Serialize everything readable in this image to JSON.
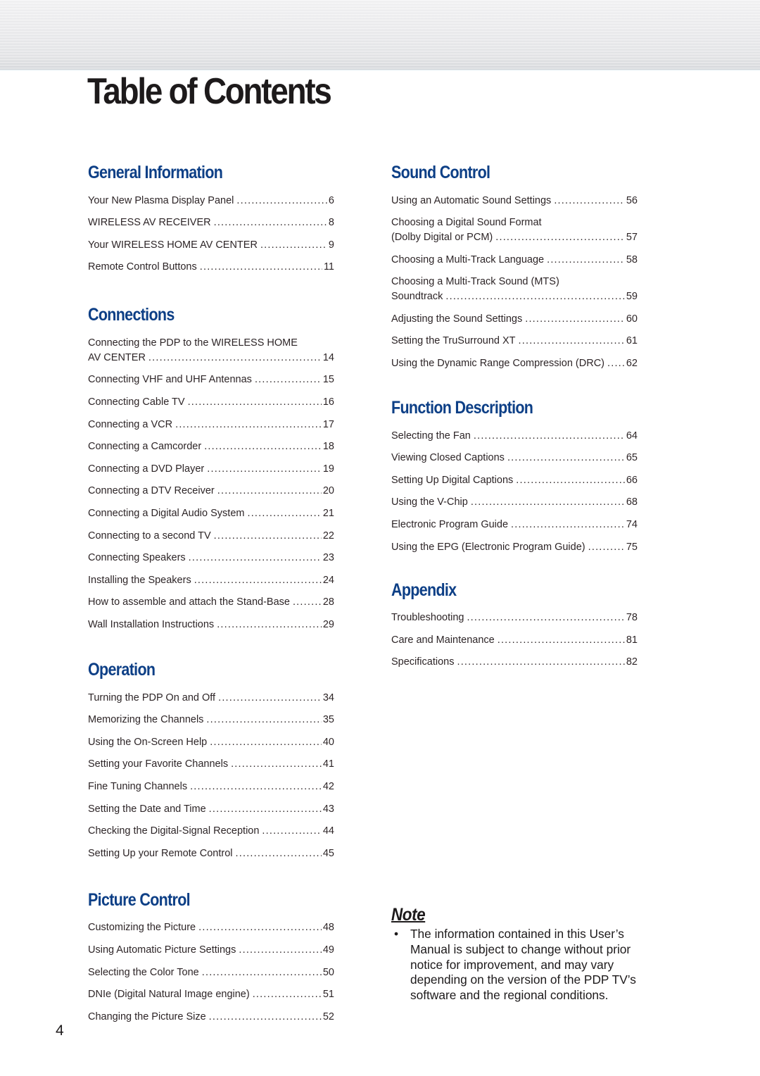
{
  "page": {
    "title": "Table of Contents",
    "page_number": "4"
  },
  "sections": {
    "general": {
      "title": "General Information",
      "entries": [
        {
          "label": "Your New Plasma Display Panel",
          "page": "6"
        },
        {
          "label": "WIRELESS AV RECEIVER",
          "page": "8"
        },
        {
          "label": "Your WIRELESS HOME AV CENTER",
          "page": "9"
        },
        {
          "label": "Remote Control Buttons",
          "page": "11"
        }
      ]
    },
    "connections": {
      "title": "Connections",
      "entries": [
        {
          "label_line1": "Connecting the PDP to the WIRELESS HOME",
          "label": "AV CENTER",
          "page": "14"
        },
        {
          "label": "Connecting VHF and UHF Antennas",
          "page": "15"
        },
        {
          "label": "Connecting Cable TV",
          "page": "16"
        },
        {
          "label": "Connecting a VCR",
          "page": "17"
        },
        {
          "label": "Connecting a Camcorder",
          "page": "18"
        },
        {
          "label": "Connecting a DVD Player",
          "page": "19"
        },
        {
          "label": "Connecting a DTV Receiver",
          "page": "20"
        },
        {
          "label": "Connecting a Digital Audio System",
          "page": "21"
        },
        {
          "label": "Connecting to a second TV",
          "page": "22"
        },
        {
          "label": "Connecting Speakers",
          "page": "23"
        },
        {
          "label": "Installing the Speakers",
          "page": "24"
        },
        {
          "label": "How to assemble and attach the Stand-Base",
          "page": "28"
        },
        {
          "label": "Wall Installation Instructions",
          "page": "29"
        }
      ]
    },
    "operation": {
      "title": "Operation",
      "entries": [
        {
          "label": "Turning the PDP On and Off",
          "page": "34"
        },
        {
          "label": "Memorizing the Channels",
          "page": "35"
        },
        {
          "label": "Using the On-Screen Help",
          "page": "40"
        },
        {
          "label": "Setting your Favorite Channels",
          "page": "41"
        },
        {
          "label": "Fine Tuning Channels",
          "page": "42"
        },
        {
          "label": "Setting the Date and Time",
          "page": "43"
        },
        {
          "label": "Checking the Digital-Signal Reception",
          "page": "44"
        },
        {
          "label": "Setting Up your Remote Control",
          "page": "45"
        }
      ]
    },
    "picture": {
      "title": "Picture Control",
      "entries": [
        {
          "label": "Customizing the Picture",
          "page": "48"
        },
        {
          "label": "Using Automatic Picture Settings",
          "page": "49"
        },
        {
          "label": "Selecting the Color Tone",
          "page": "50"
        },
        {
          "label": "DNIe (Digital Natural Image engine)",
          "page": "51"
        },
        {
          "label": "Changing the Picture Size",
          "page": "52"
        }
      ]
    },
    "sound": {
      "title": "Sound Control",
      "entries": [
        {
          "label": "Using an Automatic Sound Settings",
          "page": "56"
        },
        {
          "label_line1": "Choosing a Digital Sound Format",
          "label": "(Dolby Digital or PCM)",
          "page": "57"
        },
        {
          "label": "Choosing a Multi-Track Language",
          "page": "58"
        },
        {
          "label_line1": "Choosing a Multi-Track Sound (MTS)",
          "label": "Soundtrack",
          "page": "59"
        },
        {
          "label": "Adjusting the Sound Settings",
          "page": "60"
        },
        {
          "label": "Setting the TruSurround XT",
          "page": "61"
        },
        {
          "label": "Using the Dynamic Range Compression (DRC)",
          "page": "62"
        }
      ]
    },
    "function": {
      "title": "Function Description",
      "entries": [
        {
          "label": "Selecting the Fan",
          "page": "64"
        },
        {
          "label": "Viewing Closed Captions",
          "page": "65"
        },
        {
          "label": "Setting Up Digital Captions",
          "page": "66"
        },
        {
          "label": "Using the V-Chip",
          "page": "68"
        },
        {
          "label": "Electronic Program Guide",
          "page": "74"
        },
        {
          "label": "Using the EPG (Electronic Program Guide)",
          "page": "75"
        }
      ]
    },
    "appendix": {
      "title": "Appendix",
      "entries": [
        {
          "label": "Troubleshooting",
          "page": "78"
        },
        {
          "label": "Care and Maintenance",
          "page": "81"
        },
        {
          "label": "Specifications",
          "page": "82"
        }
      ]
    }
  },
  "note": {
    "title": "Note",
    "bullet": "•",
    "items": [
      "The information contained in this User’s Manual is subject to change without prior notice for improvement, and may vary depending on the version of the PDP TV’s software and the regional conditions."
    ]
  },
  "colors": {
    "section_heading": "#0d3f86",
    "body_text": "#2d2527",
    "title_text": "#1d1a1b"
  }
}
